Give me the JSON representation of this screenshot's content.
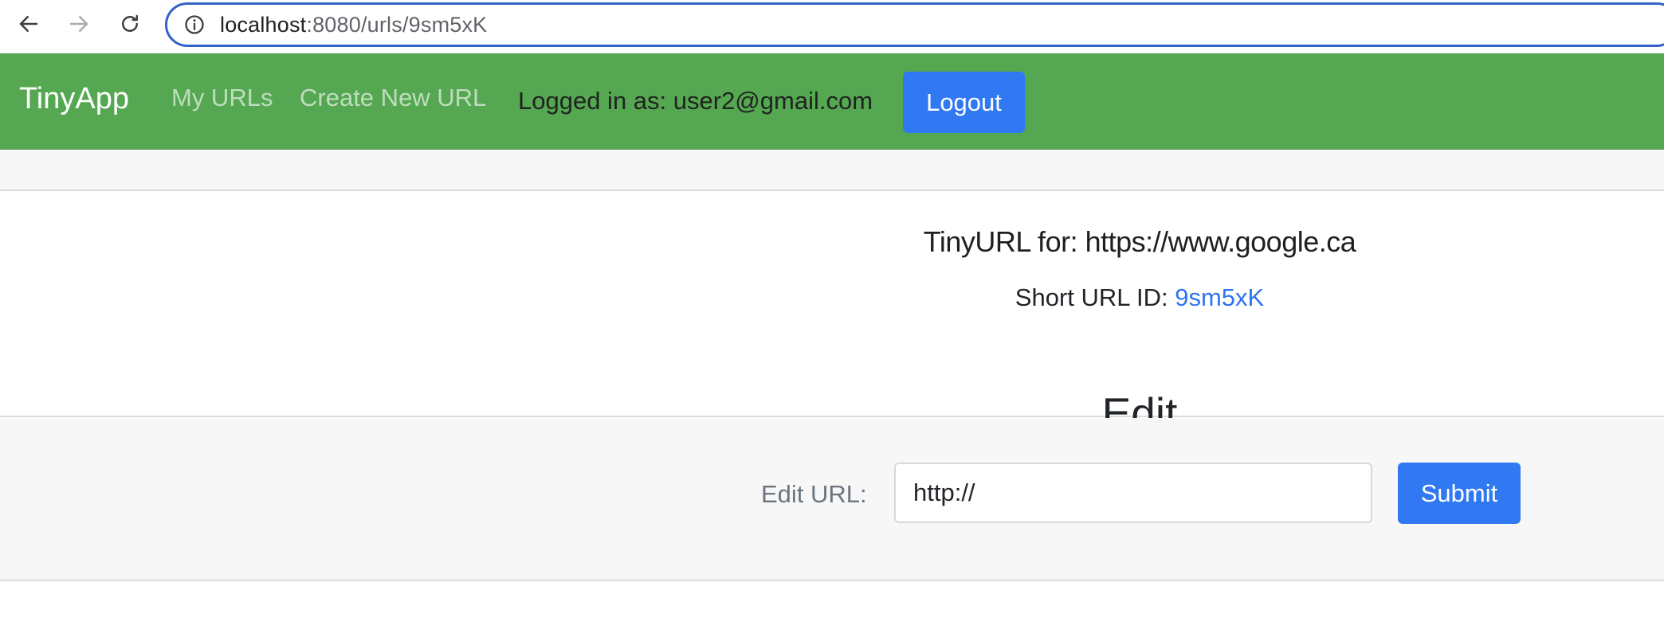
{
  "browser": {
    "url_host": "localhost",
    "url_path": ":8080/urls/9sm5xK",
    "icons": {
      "back": "arrow-left-icon",
      "forward": "arrow-right-icon",
      "reload": "reload-icon",
      "site_info": "info-circle-icon"
    }
  },
  "navbar": {
    "brand": "TinyApp",
    "links": [
      {
        "label": "My URLs"
      },
      {
        "label": "Create New URL"
      }
    ],
    "logged_in_text": "Logged in as: user2@gmail.com",
    "logout_label": "Logout",
    "colors": {
      "background": "#55a751",
      "button": "#3079f3"
    }
  },
  "card": {
    "title": "TinyURL for: https://www.google.ca",
    "short_label": "Short URL ID: ",
    "short_id": "9sm5xK",
    "edit_heading": "Edit"
  },
  "form": {
    "label": "Edit URL:",
    "input_placeholder": "http://",
    "submit_label": "Submit"
  }
}
